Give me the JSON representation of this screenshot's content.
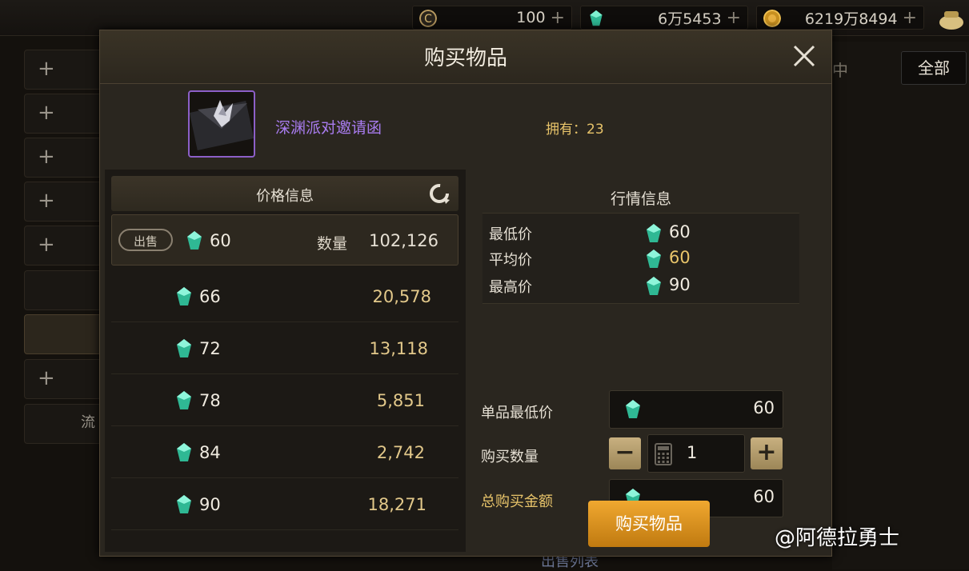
{
  "topbar": {
    "currencies": [
      {
        "icon": "c-coin-icon",
        "value": "100"
      },
      {
        "icon": "gem-icon",
        "value": "6万5453"
      },
      {
        "icon": "gold-coin-icon",
        "value": "6219万8494"
      }
    ]
  },
  "background": {
    "zhong_label": "中",
    "filter_label": "全部",
    "sidebar_text_item": "流",
    "bottom_link": "出售列表"
  },
  "dialog": {
    "title": "购买物品",
    "item": {
      "name": "深渊派对邀请函",
      "owned": "拥有：23",
      "name_color": "#a97cf0"
    },
    "price_panel": {
      "title": "价格信息",
      "sell_badge": "出售",
      "qty_label": "数量",
      "listings": [
        {
          "price": "60",
          "quantity": "102,126"
        },
        {
          "price": "66",
          "quantity": "20,578"
        },
        {
          "price": "72",
          "quantity": "13,118"
        },
        {
          "price": "78",
          "quantity": "5,851"
        },
        {
          "price": "84",
          "quantity": "2,742"
        },
        {
          "price": "90",
          "quantity": "18,271"
        }
      ]
    },
    "market_panel": {
      "title": "行情信息",
      "rows": [
        {
          "label": "最低价",
          "value": "60"
        },
        {
          "label": "平均价",
          "value": "60"
        },
        {
          "label": "最高价",
          "value": "90"
        }
      ]
    },
    "form": {
      "unit_price_label": "单品最低价",
      "unit_price": "60",
      "quantity_label": "购买数量",
      "quantity": "1",
      "minus": "−",
      "plus": "+",
      "total_label": "总购买金额",
      "total": "60",
      "buy_button": "购买物品"
    }
  },
  "watermark": "@阿德拉勇士",
  "colors": {
    "accent": "#e0a020",
    "gem": "#3ad0a8",
    "highlight": "#e8c46a"
  }
}
